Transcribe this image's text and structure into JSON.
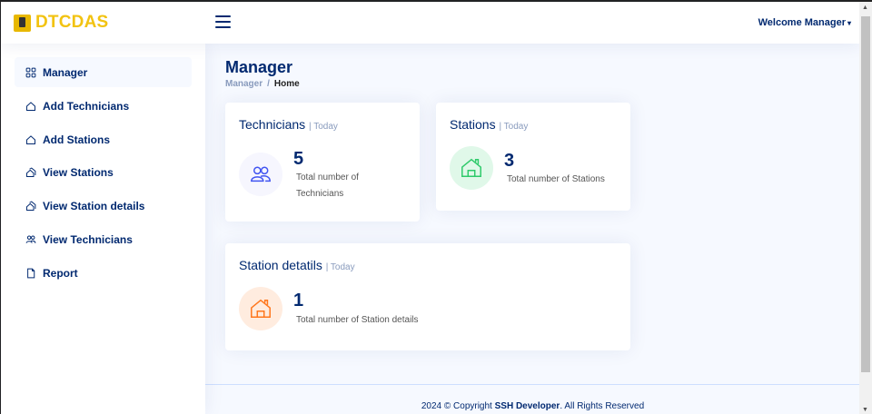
{
  "app": {
    "logo_text": "DTCDAS"
  },
  "header": {
    "user_label": "Welcome Manager",
    "user_caret": "▾"
  },
  "sidebar": {
    "items": [
      {
        "label": "Manager",
        "icon": "grid-icon"
      },
      {
        "label": "Add Technicians",
        "icon": "house-icon"
      },
      {
        "label": "Add Stations",
        "icon": "house-icon"
      },
      {
        "label": "View Stations",
        "icon": "houses-icon"
      },
      {
        "label": "View Station details",
        "icon": "houses-icon"
      },
      {
        "label": "View Technicians",
        "icon": "people-icon"
      },
      {
        "label": "Report",
        "icon": "file-icon"
      }
    ]
  },
  "page": {
    "title": "Manager",
    "breadcrumb": {
      "link": "Manager",
      "separator": "/",
      "current": "Home"
    }
  },
  "cards": {
    "technicians": {
      "title": "Technicians",
      "sub": "| Today",
      "value": "5",
      "label": "Total number of Technicians",
      "icon": "people-icon",
      "color": "#4154f1",
      "bg": "#f6f6fe"
    },
    "stations": {
      "title": "Stations",
      "sub": "| Today",
      "value": "3",
      "label": "Total number of Stations",
      "icon": "house-icon",
      "color": "#2eca6a",
      "bg": "#e0f8e9"
    },
    "station_details": {
      "title": "Station detatils",
      "sub": "| Today",
      "value": "1",
      "label": "Total number of Station details",
      "icon": "house-icon",
      "color": "#ff771d",
      "bg": "#ffecdf"
    }
  },
  "footer": {
    "prefix": "2024 © Copyright ",
    "brand": "SSH Developer",
    "suffix": ". All Rights Reserved"
  }
}
